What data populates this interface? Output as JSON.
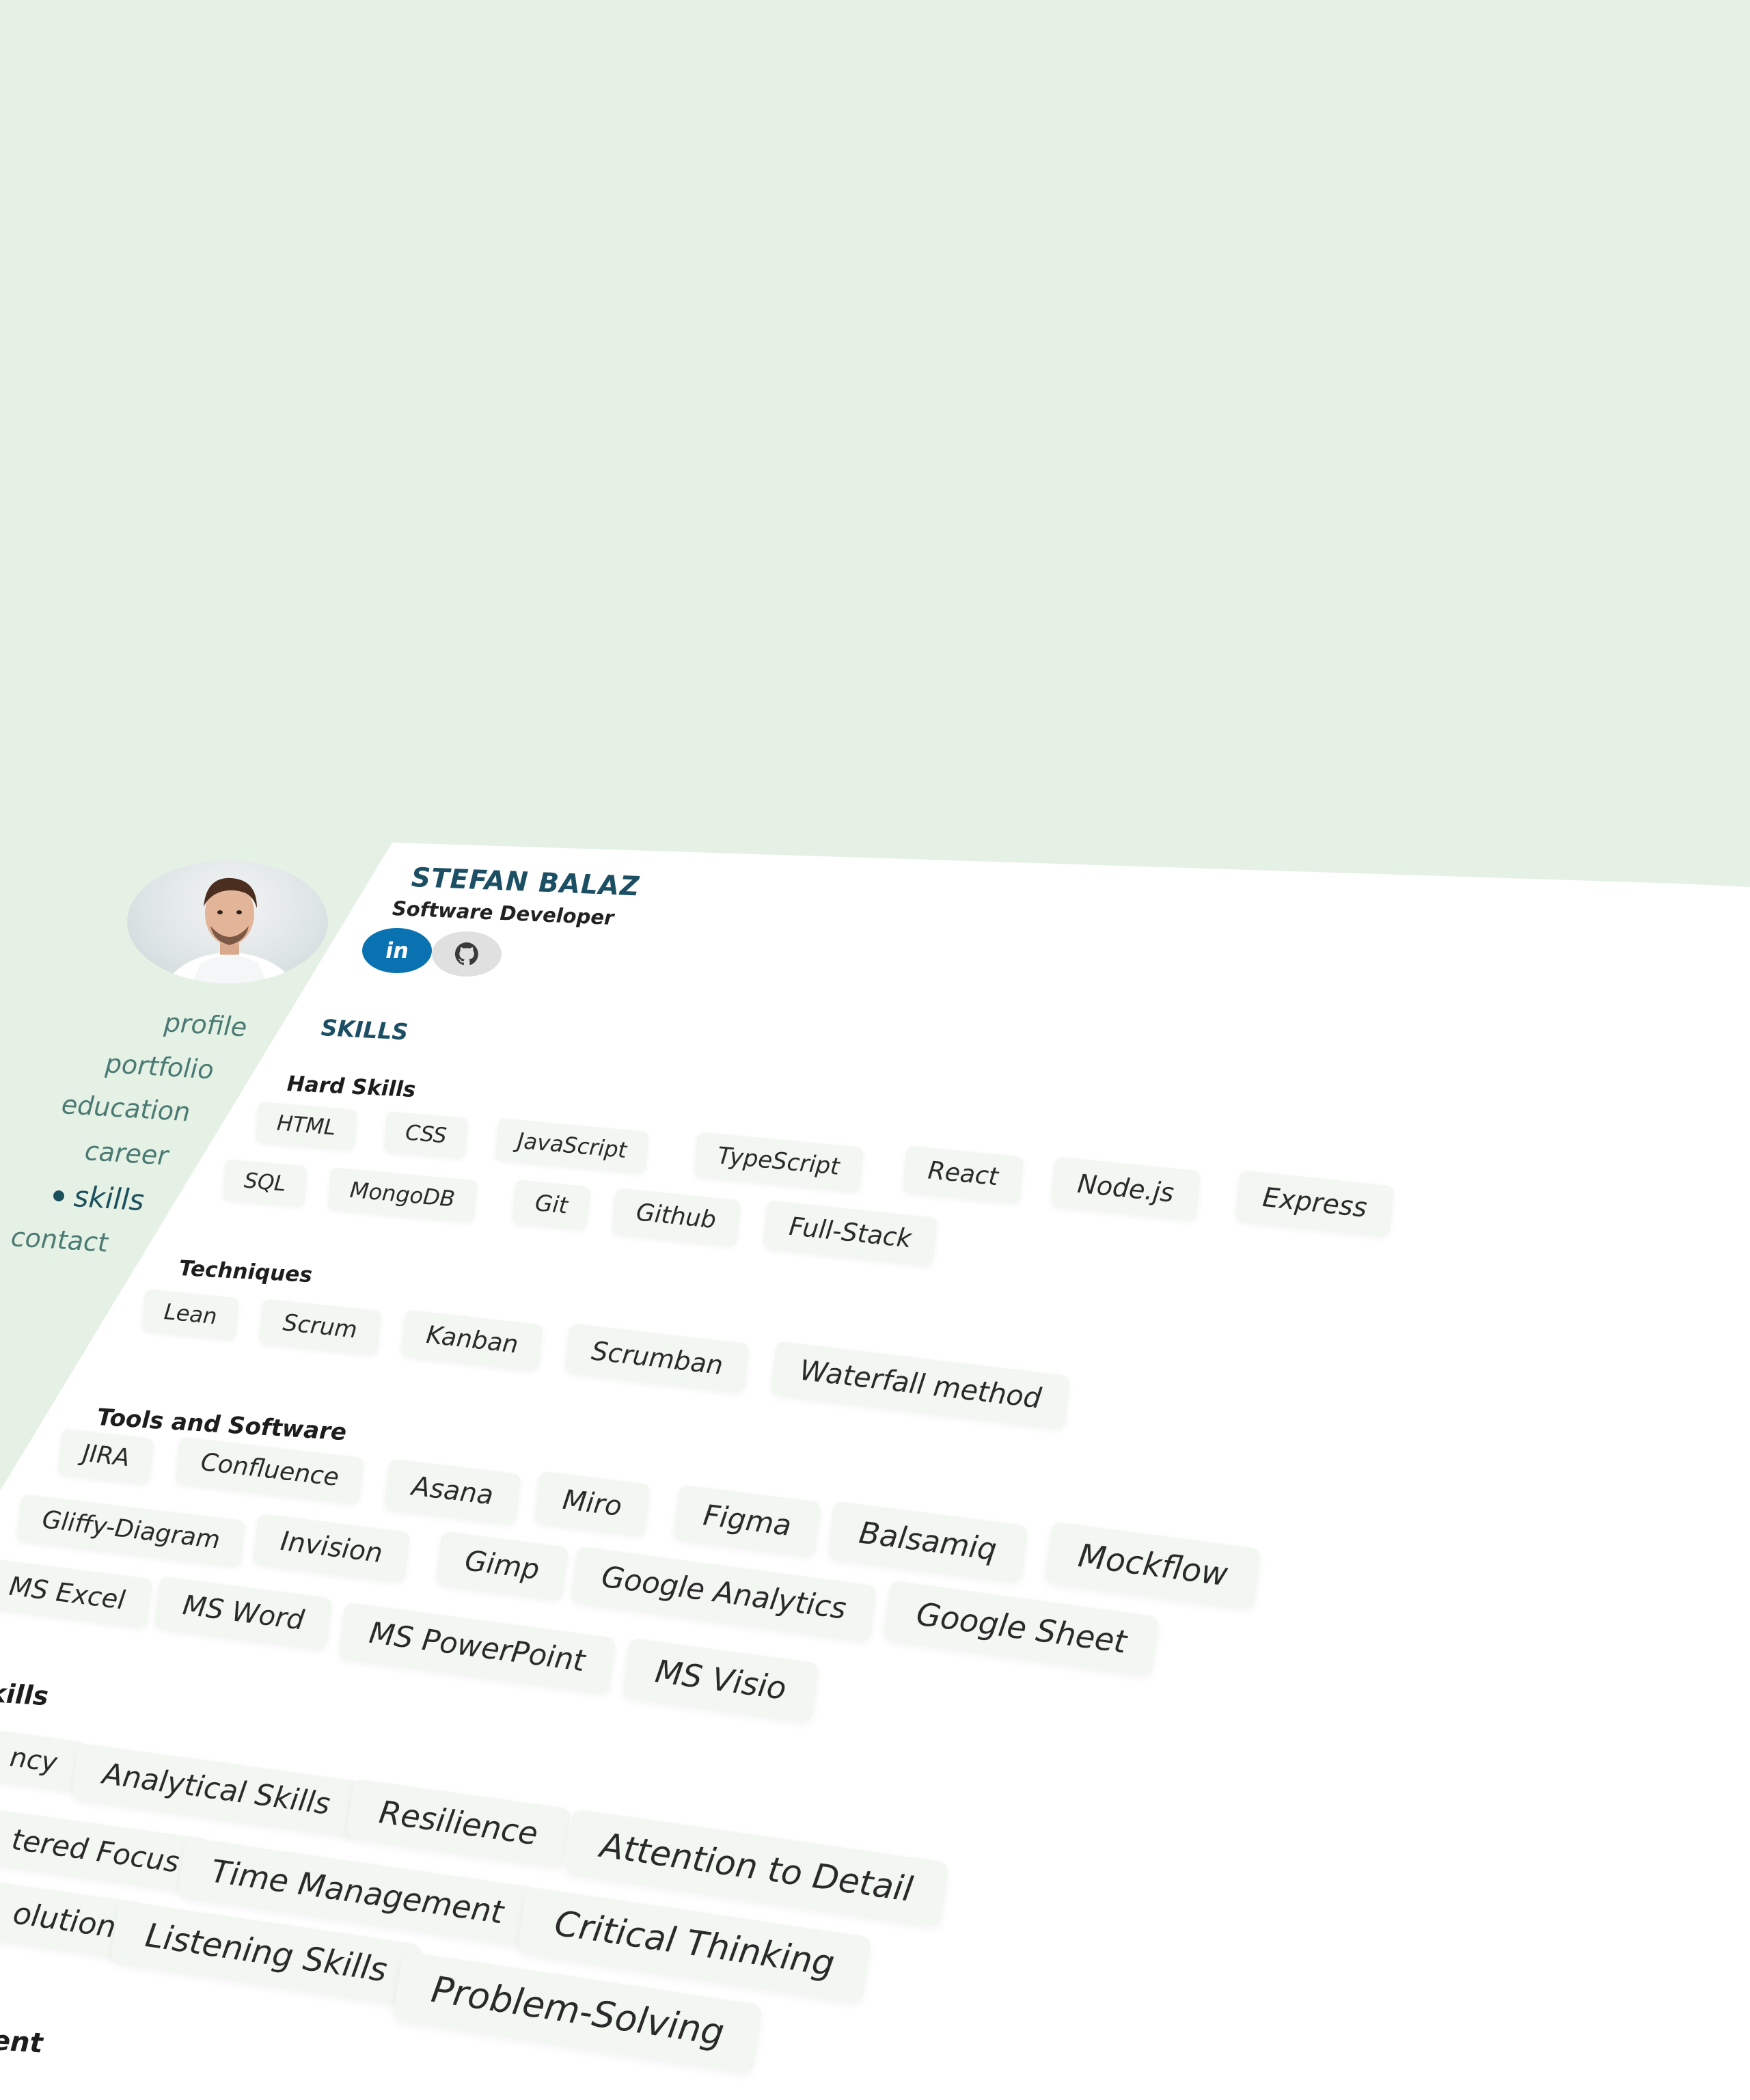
{
  "profile": {
    "name": "STEFAN BALAZ",
    "role": "Software Developer",
    "linkedin_label": "in",
    "icons": {
      "linkedin": "linkedin-icon",
      "github": "github-icon"
    }
  },
  "nav": {
    "items": [
      {
        "label": "profile",
        "active": false
      },
      {
        "label": "portfolio",
        "active": false
      },
      {
        "label": "education",
        "active": false
      },
      {
        "label": "career",
        "active": false
      },
      {
        "label": "skills",
        "active": true
      },
      {
        "label": "contact",
        "active": false
      }
    ]
  },
  "section": {
    "title": "SKILLS"
  },
  "groups": [
    {
      "title": "Hard Skills",
      "tags": [
        "HTML",
        "CSS",
        "JavaScript",
        "TypeScript",
        "React",
        "Node.js",
        "Express",
        "SQL",
        "MongoDB",
        "Git",
        "Github",
        "Full-Stack"
      ]
    },
    {
      "title": "Techniques",
      "tags": [
        "Lean",
        "Scrum",
        "Kanban",
        "Scrumban",
        "Waterfall method"
      ]
    },
    {
      "title": "Tools and Software",
      "tags": [
        "JIRA",
        "Confluence",
        "Asana",
        "Miro",
        "Figma",
        "Balsamiq",
        "Mockflow",
        "Gliffy-Diagram",
        "Invision",
        "Gimp",
        "Google Analytics",
        "Google Sheet",
        "MS Excel",
        "MS Word",
        "MS PowerPoint",
        "MS Visio"
      ]
    },
    {
      "title": "kills",
      "tags": [
        "ncy",
        "Analytical Skills",
        "Resilience",
        "Attention to Detail",
        "tered Focus",
        "Time Management",
        "Critical Thinking",
        "olution",
        "Listening Skills",
        "Problem-Solving"
      ]
    },
    {
      "title": "ent",
      "tags": []
    }
  ],
  "colors": {
    "background": "#e6f1e6",
    "card": "#ffffff",
    "accent": "#1c4f63",
    "tag_bg": "#f2f7f1",
    "linkedin": "#0a72b1"
  }
}
